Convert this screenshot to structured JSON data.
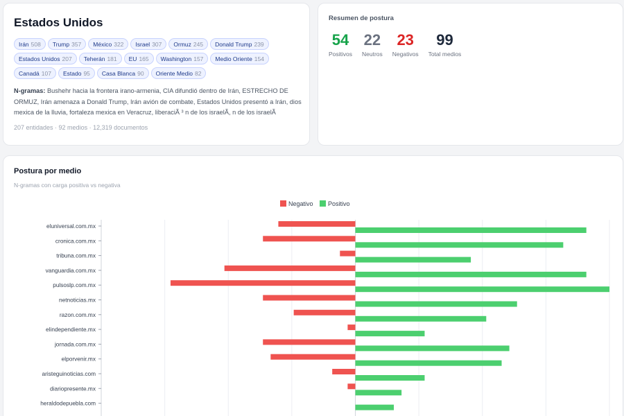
{
  "entity": {
    "title": "Estados Unidos",
    "tags": [
      {
        "name": "Irán",
        "count": "508"
      },
      {
        "name": "Trump",
        "count": "357"
      },
      {
        "name": "México",
        "count": "322"
      },
      {
        "name": "Israel",
        "count": "307"
      },
      {
        "name": "Ormuz",
        "count": "245"
      },
      {
        "name": "Donald Trump",
        "count": "239"
      },
      {
        "name": "Estados Unidos",
        "count": "207"
      },
      {
        "name": "Teherán",
        "count": "181"
      },
      {
        "name": "EU",
        "count": "165"
      },
      {
        "name": "Washington",
        "count": "157"
      },
      {
        "name": "Medio Oriente",
        "count": "154"
      },
      {
        "name": "Canadá",
        "count": "107"
      },
      {
        "name": "Estado",
        "count": "95"
      },
      {
        "name": "Casa Blanca",
        "count": "90"
      },
      {
        "name": "Oriente Medio",
        "count": "82"
      }
    ],
    "ngrams_label": "N-gramas:",
    "ngrams_text": "Bushehr hacia la frontera irano-armenia, CIA difundió dentro de Irán, ESTRECHO DE ORMUZ, Irán amenaza a Donald Trump, Irán avión de combate, Estados Unidos presentó a Irán, dios mexica de la lluvia, fortaleza mexica en Veracruz, liberaciÃ ³ n de los israelÃ, n de los israelÃ",
    "meta": "207 entidades · 92 medios · 12,319 documentos"
  },
  "summary": {
    "title": "Resumen de postura",
    "stats": [
      {
        "value": "54",
        "label": "Positivos",
        "color": "#16a34a"
      },
      {
        "value": "22",
        "label": "Neutros",
        "color": "#6b7280"
      },
      {
        "value": "23",
        "label": "Negativos",
        "color": "#dc2626"
      },
      {
        "value": "99",
        "label": "Total medios",
        "color": "#1e293b"
      }
    ]
  },
  "chart_section": {
    "title": "Postura por medio",
    "subtitle": "N-gramas con carga positiva vs negativa"
  },
  "chart_data": {
    "type": "bar",
    "orientation": "horizontal",
    "legend_position": "top-center",
    "grid": true,
    "colors": {
      "negative": "#ef5350",
      "positive": "#4ccf6f"
    },
    "categories": [
      "eluniversal.com.mx",
      "cronica.com.mx",
      "tribuna.com.mx",
      "vanguardia.com.mx",
      "pulsoslp.com.mx",
      "netnoticias.mx",
      "razon.com.mx",
      "elindependiente.mx",
      "jornada.com.mx",
      "elporvenir.mx",
      "aristeguinoticias.com",
      "diariopresente.mx",
      "heraldodepuebla.com"
    ],
    "series": [
      {
        "name": "Negativo",
        "values": [
          -10,
          -12,
          -2,
          -17,
          -24,
          -12,
          -8,
          -1,
          -12,
          -11,
          -3,
          -1,
          0
        ]
      },
      {
        "name": "Positivo",
        "values": [
          30,
          27,
          15,
          30,
          33,
          21,
          17,
          9,
          20,
          19,
          9,
          6,
          5
        ]
      }
    ],
    "xlim": [
      -33,
      33
    ]
  }
}
